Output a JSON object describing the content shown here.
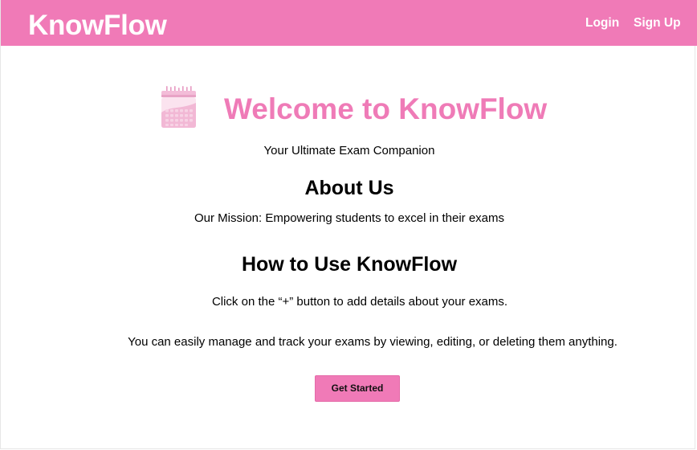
{
  "navbar": {
    "brand": "KnowFlow",
    "login_label": "Login",
    "signup_label": "Sign Up",
    "background_color": "#f07ab7"
  },
  "hero": {
    "icon": "calendar-icon",
    "title": "Welcome to KnowFlow",
    "title_color": "#ef7bb7",
    "tagline": "Your Ultimate Exam Companion"
  },
  "about": {
    "heading": "About Us",
    "mission": "Our Mission: Empowering students to excel in their exams"
  },
  "how_to": {
    "heading": "How to Use KnowFlow",
    "step1": "Click on the “+” button to add details about your exams.",
    "step2": "You can easily manage and track your exams by viewing, editing, or deleting them anything."
  },
  "cta": {
    "label": "Get Started"
  }
}
